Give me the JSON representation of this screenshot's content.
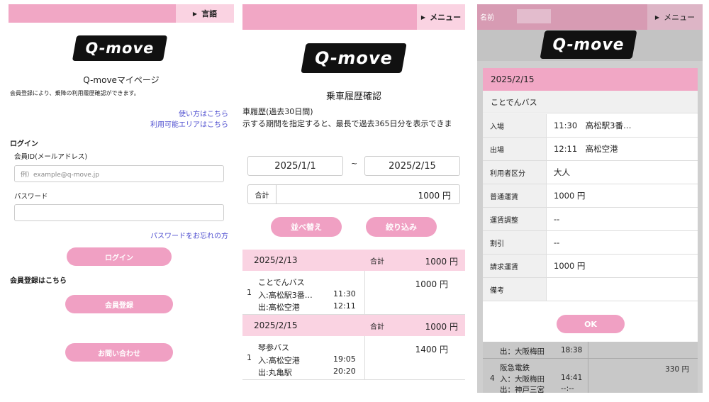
{
  "login_screen": {
    "lang_button": "言語",
    "logo": "Q-move",
    "title": "Q-moveマイページ",
    "description": "会員登録により、乗降の利用履歴確認ができます。",
    "link_howto": "使い方はこちら",
    "link_area": "利用可能エリアはこちら",
    "login_heading": "ログイン",
    "member_id_label": "会員ID(メールアドレス)",
    "member_id_placeholder": "例）example@q-move.jp",
    "password_label": "パスワード",
    "forgot_password": "パスワードをお忘れの方",
    "login_button": "ログイン",
    "register_heading": "会員登録はこちら",
    "register_button": "会員登録",
    "contact_button": "お問い合わせ"
  },
  "history_screen": {
    "menu_button": "メニュー",
    "logo": "Q-move",
    "title": "乗車履歴確認",
    "subtitle": "車履歴(過去30日間)",
    "note": "示する期間を指定すると、最長で過去365日分を表示できま",
    "date_from": "2025/1/1",
    "date_separator": "~",
    "date_to": "2025/2/15",
    "total_label": "合計",
    "total_value": "1000 円",
    "sort_button": "並べ替え",
    "filter_button": "絞り込み",
    "groups": [
      {
        "date": "2025/2/13",
        "total_label": "合計",
        "total": "1000 円",
        "rides": [
          {
            "no": "1",
            "operator": "ことでんバス",
            "fare": "1000 円",
            "in_label": "入:高松駅3番…",
            "in_time": "11:30",
            "out_label": "出:高松空港",
            "out_time": "12:11"
          }
        ]
      },
      {
        "date": "2025/2/15",
        "total_label": "合計",
        "total": "1000 円",
        "rides": [
          {
            "no": "1",
            "operator": "琴参バス",
            "fare": "1400 円",
            "in_label": "入:高松空港",
            "in_time": "19:05",
            "out_label": "出:丸亀駅",
            "out_time": "20:20"
          }
        ]
      }
    ]
  },
  "detail_screen": {
    "name_label": "名前",
    "menu_button": "メニュー",
    "logo": "Q-move",
    "date": "2025/2/15",
    "operator": "ことでんバス",
    "rows": [
      {
        "label": "入場",
        "value": "11:30　高松駅3番…"
      },
      {
        "label": "出場",
        "value": "12:11　高松空港"
      },
      {
        "label": "利用者区分",
        "value": "大人"
      },
      {
        "label": "普通運賃",
        "value": "1000 円"
      },
      {
        "label": "運賃調整",
        "value": "--"
      },
      {
        "label": "割引",
        "value": "--"
      },
      {
        "label": "請求運賃",
        "value": "1000 円"
      },
      {
        "label": "備考",
        "value": ""
      }
    ],
    "ok_button": "OK",
    "background_list": {
      "row1_out_label": "出：大阪梅田",
      "row1_out_time": "18:38",
      "row2_no": "4",
      "row2_operator": "阪急電鉄",
      "row2_fare": "330 円",
      "row2_in_label": "入：大阪梅田",
      "row2_in_time": "14:41",
      "row2_out_label": "出：神戸三宮",
      "row2_out_time": "--:--"
    }
  }
}
